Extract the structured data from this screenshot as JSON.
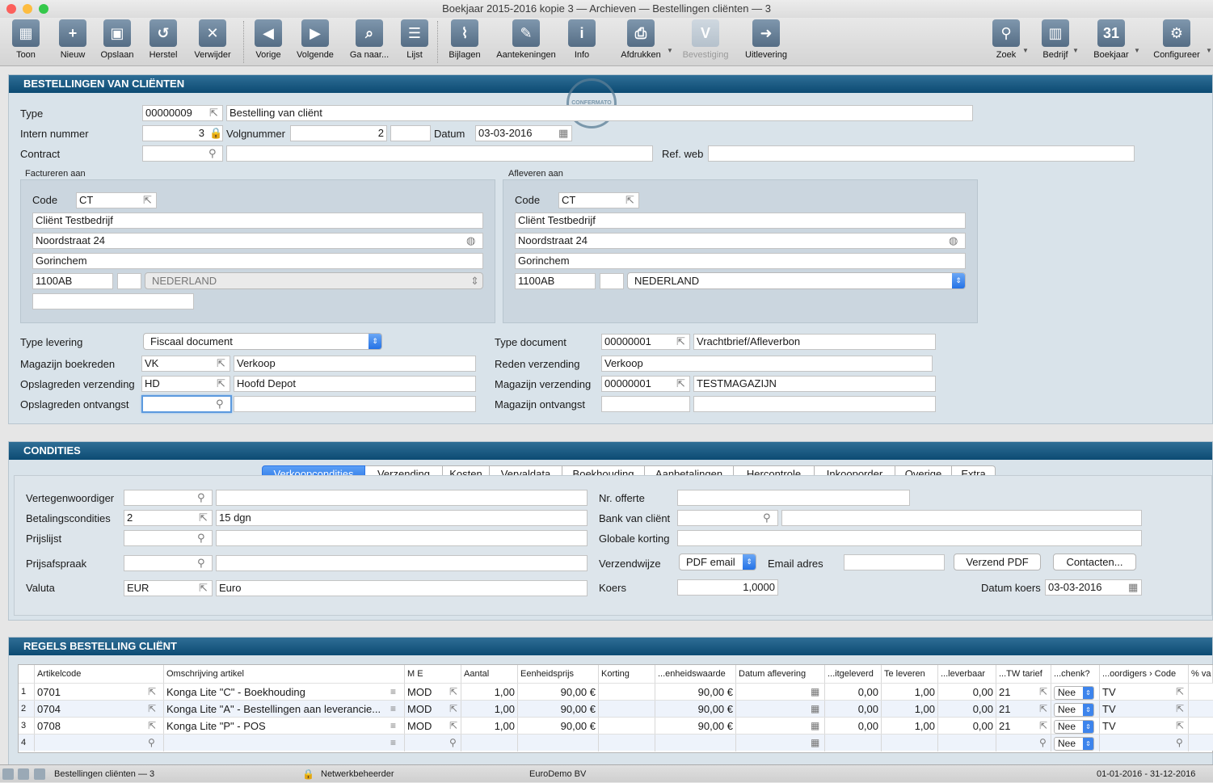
{
  "window": {
    "title": "Boekjaar 2015-2016 kopie 3 — Archieven — Bestellingen cliënten — 3"
  },
  "toolbar": {
    "items": [
      {
        "label": "Toon",
        "icon": "toon-icon",
        "glyph": "▦"
      },
      {
        "label": "Nieuw",
        "icon": "new-document-icon",
        "glyph": "+"
      },
      {
        "label": "Opslaan",
        "icon": "save-disk-icon",
        "glyph": "▣"
      },
      {
        "label": "Herstel",
        "icon": "undo-arrow-icon",
        "glyph": "↺"
      },
      {
        "label": "Verwijder",
        "icon": "delete-icon",
        "glyph": "✕"
      },
      {
        "label": "Vorige",
        "icon": "previous-icon",
        "glyph": "◀"
      },
      {
        "label": "Volgende",
        "icon": "next-icon",
        "glyph": "▶"
      },
      {
        "label": "Ga naar...",
        "icon": "goto-icon",
        "glyph": "⌕"
      },
      {
        "label": "Lijst",
        "icon": "list-icon",
        "glyph": "☰"
      },
      {
        "label": "Bijlagen",
        "icon": "paperclip-icon",
        "glyph": "⌇"
      },
      {
        "label": "Aantekeningen",
        "icon": "notes-icon",
        "glyph": "✎"
      },
      {
        "label": "Info",
        "icon": "info-icon",
        "glyph": "i"
      },
      {
        "label": "Afdrukken",
        "icon": "printer-icon",
        "glyph": "⎙"
      },
      {
        "label": "Bevestiging",
        "icon": "confirm-icon",
        "glyph": "V"
      },
      {
        "label": "Uitlevering",
        "icon": "export-icon",
        "glyph": "➜"
      },
      {
        "label": "Zoek",
        "icon": "search-icon",
        "glyph": "⚲"
      },
      {
        "label": "Bedrijf",
        "icon": "company-icon",
        "glyph": "▥"
      },
      {
        "label": "Boekjaar",
        "icon": "calendar-icon",
        "glyph": "31"
      },
      {
        "label": "Configureer",
        "icon": "gear-icon",
        "glyph": "⚙"
      }
    ]
  },
  "header": {
    "title": "BESTELLINGEN VAN CLIËNTEN",
    "stamp": "CONFERMATO",
    "type_label": "Type",
    "type_code": "00000009",
    "type_desc": "Bestelling van cliënt",
    "intern_label": "Intern nummer",
    "intern_value": "3",
    "volg_label": "Volgnummer",
    "volg_value": "2",
    "datum_label": "Datum",
    "datum_value": "03-03-2016",
    "contract_label": "Contract",
    "refweb_label": "Ref. web"
  },
  "bill": {
    "title": "Factureren aan",
    "code_label": "Code",
    "code": "CT",
    "name": "Cliënt Testbedrijf",
    "street": "Noordstraat 24",
    "city": "Gorinchem",
    "zip": "1100AB",
    "country": "NEDERLAND"
  },
  "ship": {
    "title": "Afleveren aan",
    "code_label": "Code",
    "code": "CT",
    "name": "Cliënt Testbedrijf",
    "street": "Noordstraat 24",
    "city": "Gorinchem",
    "zip": "1100AB",
    "country": "NEDERLAND"
  },
  "logistics": {
    "type_levering_label": "Type levering",
    "type_levering": "Fiscaal document",
    "magazijn_boek_label": "Magazijn boekreden",
    "magazijn_boek_code": "VK",
    "magazijn_boek_desc": "Verkoop",
    "opslag_verz_label": "Opslagreden verzending",
    "opslag_verz_code": "HD",
    "opslag_verz_desc": "Hoofd Depot",
    "opslag_ontv_label": "Opslagreden ontvangst",
    "type_doc_label": "Type document",
    "type_doc_code": "00000001",
    "type_doc_desc": "Vrachtbrief/Afleverbon",
    "reden_verz_label": "Reden verzending",
    "reden_verz": "Verkoop",
    "mag_verz_label": "Magazijn verzending",
    "mag_verz_code": "00000001",
    "mag_verz_desc": "TESTMAGAZIJN",
    "mag_ontv_label": "Magazijn ontvangst"
  },
  "conditions": {
    "title": "CONDITIES",
    "tabs": [
      "Verkoopcondities",
      "Verzending",
      "Kosten",
      "Vervaldata",
      "Boekhouding",
      "Aanbetalingen",
      "Hercontrole",
      "Inkooporder",
      "Overige",
      "Extra"
    ],
    "vert_label": "Vertegenwoordiger",
    "bet_label": "Betalingscondities",
    "bet_code": "2",
    "bet_desc": "15 dgn",
    "prijslijst_label": "Prijslijst",
    "prijsafspraak_label": "Prijsafspraak",
    "valuta_label": "Valuta",
    "valuta_code": "EUR",
    "valuta_desc": "Euro",
    "offerte_label": "Nr. offerte",
    "bank_label": "Bank van cliënt",
    "korting_label": "Globale korting",
    "verzendwijze_label": "Verzendwijze",
    "verzendwijze": "PDF email",
    "email_label": "Email adres",
    "verzend_pdf_btn": "Verzend PDF",
    "contacten_btn": "Contacten...",
    "koers_label": "Koers",
    "koers": "1,0000",
    "datum_koers_label": "Datum koers",
    "datum_koers": "03-03-2016"
  },
  "lines": {
    "title": "REGELS BESTELLING CLIËNT",
    "headers": [
      "Artikelcode",
      "Omschrijving artikel",
      "M E",
      "Aantal",
      "Eenheidsprijs",
      "Korting",
      "...enheidswaarde",
      "Datum aflevering",
      "...itgeleverd",
      "Te leveren",
      "...leverbaar",
      "...TW tarief",
      "...chenk?",
      "...oordigers › Code",
      "% va"
    ],
    "rows": [
      {
        "n": "1",
        "code": "0701",
        "desc": "Konga Lite \"C\" - Boekhouding",
        "me": "MOD",
        "aantal": "1,00",
        "prijs": "90,00 €",
        "korting": "",
        "waarde": "90,00 €",
        "datum": "",
        "uitgeleverd": "0,00",
        "televeren": "1,00",
        "leverbaar": "0,00",
        "btw": "21",
        "geschenk": "Nee",
        "vert": "TV"
      },
      {
        "n": "2",
        "code": "0704",
        "desc": "Konga Lite \"A\" - Bestellingen aan leverancie...",
        "me": "MOD",
        "aantal": "1,00",
        "prijs": "90,00 €",
        "korting": "",
        "waarde": "90,00 €",
        "datum": "",
        "uitgeleverd": "0,00",
        "televeren": "1,00",
        "leverbaar": "0,00",
        "btw": "21",
        "geschenk": "Nee",
        "vert": "TV"
      },
      {
        "n": "3",
        "code": "0708",
        "desc": "Konga Lite \"P\" - POS",
        "me": "MOD",
        "aantal": "1,00",
        "prijs": "90,00 €",
        "korting": "",
        "waarde": "90,00 €",
        "datum": "",
        "uitgeleverd": "0,00",
        "televeren": "1,00",
        "leverbaar": "0,00",
        "btw": "21",
        "geschenk": "Nee",
        "vert": "TV"
      },
      {
        "n": "4",
        "code": "",
        "desc": "",
        "me": "",
        "aantal": "",
        "prijs": "",
        "korting": "",
        "waarde": "",
        "datum": "",
        "uitgeleverd": "",
        "televeren": "",
        "leverbaar": "",
        "btw": "",
        "geschenk": "Nee",
        "vert": ""
      }
    ]
  },
  "status": {
    "record": "Bestellingen cliënten — 3",
    "user": "Netwerkbeheerder",
    "company": "EuroDemo BV",
    "period": "01-01-2016 - 31-12-2016"
  }
}
